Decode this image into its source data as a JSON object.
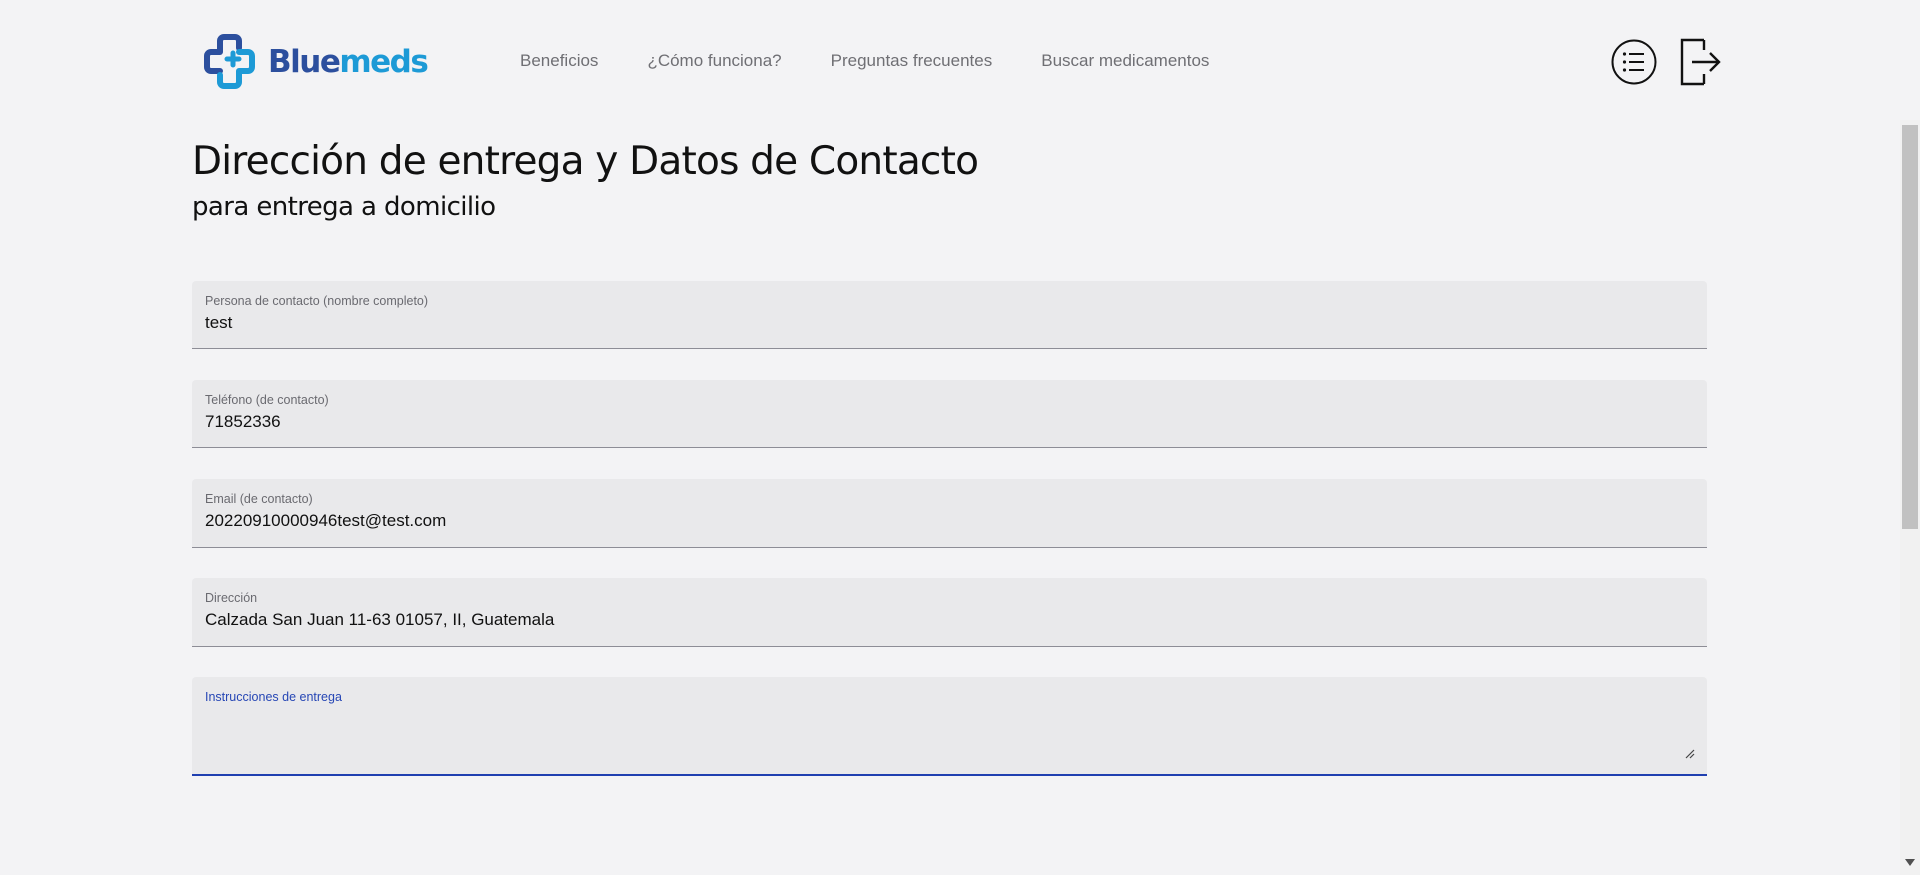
{
  "brand": {
    "name_part1": "Blue",
    "name_part2": "meds",
    "logo_icon": "cross-logo-icon",
    "color_dark": "#2c4f9e",
    "color_light": "#1d9ad6"
  },
  "nav": {
    "items": [
      {
        "label": "Beneficios"
      },
      {
        "label": "¿Cómo funciona?"
      },
      {
        "label": "Preguntas frecuentes"
      },
      {
        "label": "Buscar medicamentos"
      }
    ]
  },
  "header_actions": {
    "menu_icon": "list-menu-icon",
    "logout_icon": "logout-icon"
  },
  "page": {
    "title": "Dirección de entrega y Datos de Contacto",
    "subtitle": "para entrega a domicilio"
  },
  "form": {
    "contact_name": {
      "label": "Persona de contacto (nombre completo)",
      "value": "test"
    },
    "phone": {
      "label": "Teléfono (de contacto)",
      "value": "71852336"
    },
    "email": {
      "label": "Email (de contacto)",
      "value": "20220910000946test@test.com"
    },
    "address": {
      "label": "Dirección",
      "value": "Calzada San Juan 11-63 01057, II, Guatemala"
    },
    "instructions": {
      "label": "Instrucciones de entrega",
      "value": ""
    }
  },
  "colors": {
    "focus_accent": "#1f3fb0",
    "background": "#f3f3f5",
    "field_background": "#e9e9eb"
  }
}
